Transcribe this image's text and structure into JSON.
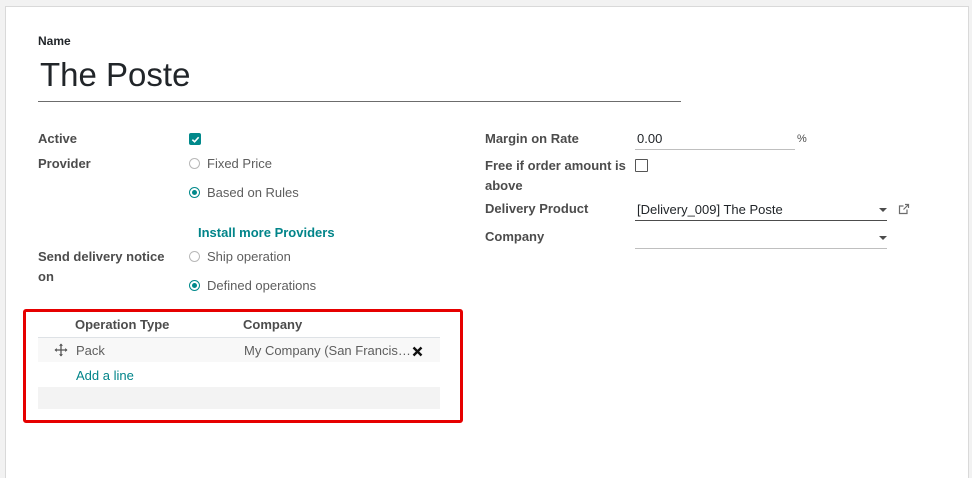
{
  "form": {
    "name_label": "Name",
    "name_value": "The Poste"
  },
  "left": {
    "active_label": "Active",
    "active_checked": true,
    "provider_label": "Provider",
    "provider_options": [
      {
        "label": "Fixed Price",
        "selected": false
      },
      {
        "label": "Based on Rules",
        "selected": true
      }
    ],
    "install_link": "Install more Providers",
    "send_notice_label_line1": "Send delivery notice",
    "send_notice_label_line2": "on",
    "send_notice_options": [
      {
        "label": "Ship operation",
        "selected": false
      },
      {
        "label": "Defined operations",
        "selected": true
      }
    ]
  },
  "right": {
    "margin_label": "Margin on Rate",
    "margin_value": "0.00",
    "margin_unit": "%",
    "free_label_line1": "Free if order amount is",
    "free_label_line2": "above",
    "free_checked": false,
    "delivery_product_label": "Delivery Product",
    "delivery_product_value": "[Delivery_009] The Poste",
    "company_label": "Company",
    "company_value": ""
  },
  "operations_table": {
    "columns": [
      "Operation Type",
      "Company"
    ],
    "rows": [
      {
        "operation_type": "Pack",
        "company": "My Company (San Francis…"
      }
    ],
    "add_line": "Add a line"
  },
  "colors": {
    "accent": "#01898b",
    "highlight_box": "#e60000"
  },
  "icons": [
    "check-icon",
    "radio-icon",
    "caret-down-icon",
    "external-link-icon",
    "drag-handle-icon",
    "delete-icon"
  ]
}
